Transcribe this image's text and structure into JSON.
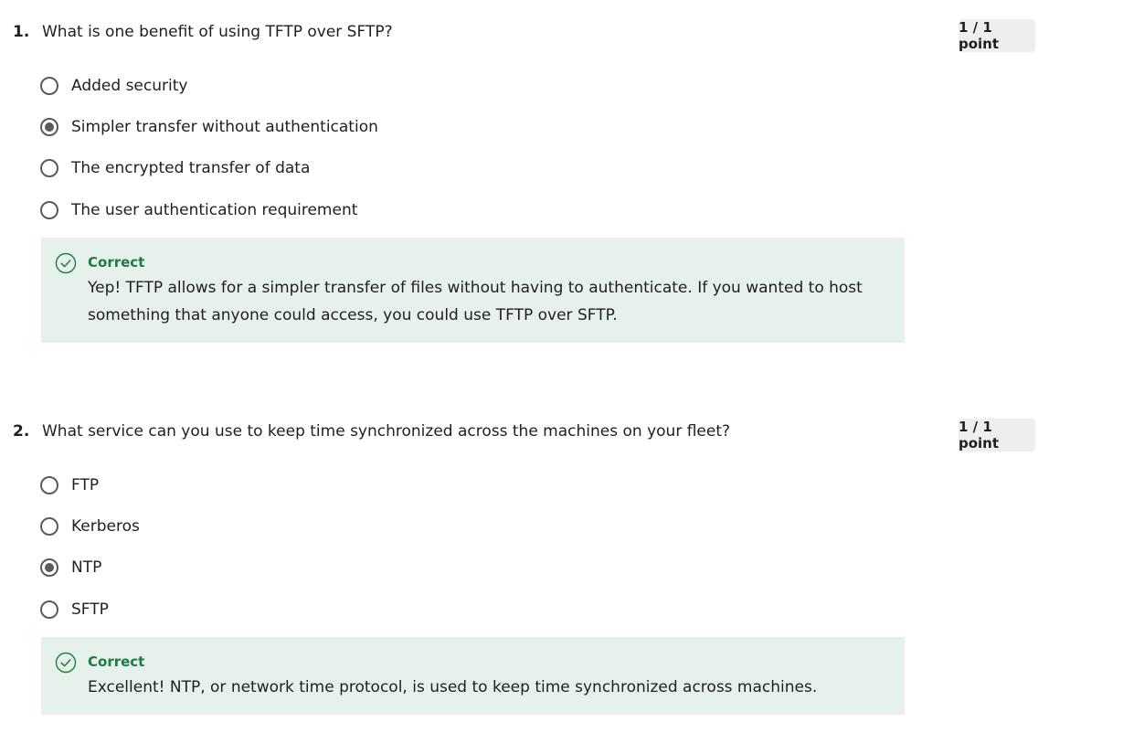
{
  "questions": [
    {
      "number": "1.",
      "text": "What is one benefit of using TFTP over SFTP?",
      "points": "1 / 1 point",
      "options": [
        {
          "label": "Added security",
          "selected": false
        },
        {
          "label": "Simpler transfer without authentication",
          "selected": true
        },
        {
          "label": "The encrypted transfer of data",
          "selected": false
        },
        {
          "label": "The user authentication requirement",
          "selected": false
        }
      ],
      "feedback": {
        "title": "Correct",
        "text": "Yep! TFTP allows for a simpler transfer of files without having to authenticate. If you wanted to host something that anyone could access, you could use TFTP over SFTP."
      }
    },
    {
      "number": "2.",
      "text": "What service can you use to keep time synchronized across the machines on your fleet?",
      "points": "1 / 1 point",
      "options": [
        {
          "label": "FTP",
          "selected": false
        },
        {
          "label": "Kerberos",
          "selected": false
        },
        {
          "label": "NTP",
          "selected": true
        },
        {
          "label": "SFTP",
          "selected": false
        }
      ],
      "feedback": {
        "title": "Correct",
        "text": "Excellent! NTP, or network time protocol, is used to keep time synchronized across machines."
      }
    }
  ],
  "colors": {
    "correct_green": "#1f7a43",
    "feedback_bg": "#e7f1ec",
    "radio_gray": "#5b5b5b",
    "points_bg": "#eeeeee"
  }
}
